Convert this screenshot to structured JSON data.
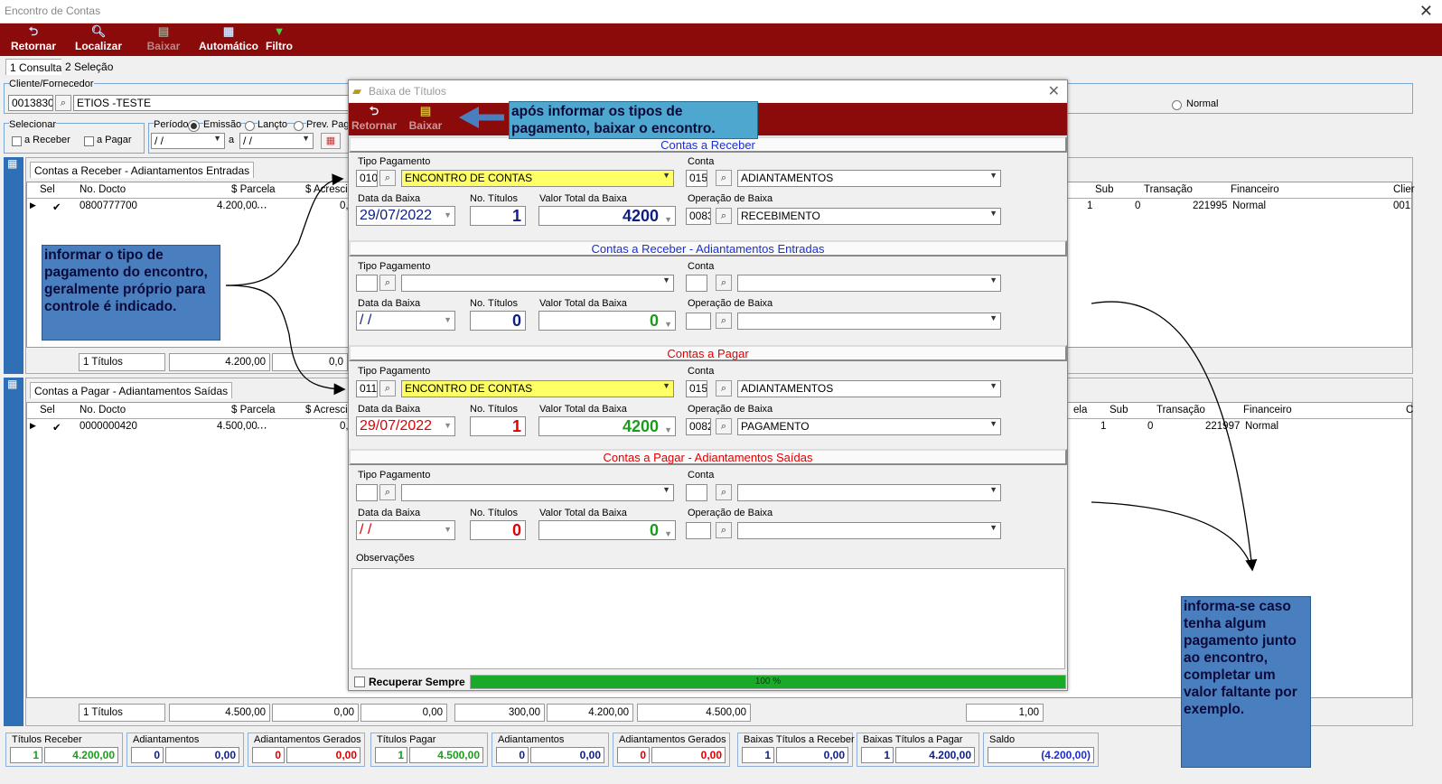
{
  "window": {
    "title": "Encontro de Contas"
  },
  "toolbar": {
    "retornar": "Retornar",
    "localizar": "Localizar",
    "baixar": "Baixar",
    "automatico": "Automático",
    "filtro": "Filtro"
  },
  "tabs": [
    "1 Consulta",
    "2 Seleção"
  ],
  "cliente": {
    "label": "Cliente/Fornecedor",
    "code": "0013830",
    "name": "ETIOS -TESTE",
    "normal": "Normal"
  },
  "selecionar": {
    "label": "Selecionar",
    "receber": "a Receber",
    "pagar": "a Pagar"
  },
  "periodo": {
    "label": "Período",
    "emissao": "Emissão",
    "lancto": "Lançto",
    "prev": "Prev. Pag",
    "de": " / /",
    "a_label": "a",
    "ate": " / /"
  },
  "receber_grid": {
    "tab": "Contas a Receber - Adiantamentos Entradas",
    "headers_left": [
      "Sel",
      "No. Docto",
      "$ Parcela",
      "$ Acrescim"
    ],
    "headers_right": [
      "Sub",
      "Transação",
      "Financeiro",
      "Clier"
    ],
    "row": {
      "docto": "0800777700",
      "parcela": "4.200,00",
      "acresc": "0,0",
      "right_a": "1",
      "sub": "0",
      "transacao": "221995",
      "financeiro": "Normal",
      "clier": "001"
    },
    "foot": {
      "titulos": "1 Títulos",
      "total": "4.200,00",
      "acresc": "0,0"
    }
  },
  "pagar_grid": {
    "tab": "Contas a Pagar - Adiantamentos Saídas",
    "headers_left": [
      "Sel",
      "No. Docto",
      "$ Parcela",
      "$ Acrescim"
    ],
    "headers_right": [
      "ela",
      "Sub",
      "Transação",
      "Financeiro",
      "C"
    ],
    "row": {
      "docto": "0000000420",
      "parcela": "4.500,00",
      "acresc": "0,0",
      "right_a": "1",
      "sub": "0",
      "transacao": "221997",
      "financeiro": "Normal"
    },
    "foot": {
      "titulos": "1 Títulos",
      "v1": "4.500,00",
      "v2": "0,00",
      "v3": "0,00",
      "v4": "300,00",
      "v5": "4.200,00",
      "v6": "4.500,00",
      "v7": "1,00"
    }
  },
  "dialog": {
    "title": "Baixa de Títulos",
    "retornar": "Retornar",
    "baixar": "Baixar",
    "labels": {
      "tipo": "Tipo Pagamento",
      "conta": "Conta",
      "data": "Data da Baixa",
      "titulos": "No. Títulos",
      "valor": "Valor Total da Baixa",
      "operacao": "Operação de Baixa"
    },
    "sec1": {
      "head": "Contas a Receber",
      "tipo_code": "010",
      "tipo_name": "ENCONTRO DE CONTAS",
      "conta_code": "015",
      "conta_name": "ADIANTAMENTOS",
      "data": "29/07/2022",
      "titulos": "1",
      "valor": "4200",
      "op_code": "0083",
      "op_name": "RECEBIMENTO"
    },
    "sec2": {
      "head": "Contas a Receber - Adiantamentos Entradas",
      "data": " / /",
      "titulos": "0",
      "valor": "0"
    },
    "sec3": {
      "head": "Contas a Pagar",
      "tipo_code": "011",
      "tipo_name": "ENCONTRO DE CONTAS",
      "conta_code": "015",
      "conta_name": "ADIANTAMENTOS",
      "data": "29/07/2022",
      "titulos": "1",
      "valor": "4200",
      "op_code": "0082",
      "op_name": "PAGAMENTO"
    },
    "sec4": {
      "head": "Contas a Pagar - Adiantamentos Saídas",
      "data": " / /",
      "titulos": "0",
      "valor": "0"
    },
    "obs_label": "Observações",
    "recuperar": "Recuperar Sempre",
    "progress": "100 %",
    "progress_value": 100
  },
  "notes": {
    "n1": "após informar os tipos de pagamento, baixar o encontro.",
    "n2": "informar o tipo de pagamento do encontro, geralmente próprio para controle é indicado.",
    "n3": "informa-se caso tenha algum pagamento junto ao encontro, completar um valor faltante por exemplo."
  },
  "summary": [
    {
      "label": "Títulos Receber",
      "n": "1",
      "v": "4.200,00",
      "color": "#1c9c1c"
    },
    {
      "label": "Adiantamentos",
      "n": "0",
      "v": "0,00",
      "color": "#0d1e86"
    },
    {
      "label": "Adiantamentos Gerados",
      "n": "0",
      "v": "0,00",
      "color": "#e00000"
    },
    {
      "label": "Títulos Pagar",
      "n": "1",
      "v": "4.500,00",
      "color": "#1c9c1c"
    },
    {
      "label": "Adiantamentos",
      "n": "0",
      "v": "0,00",
      "color": "#0d1e86"
    },
    {
      "label": "Adiantamentos Gerados",
      "n": "0",
      "v": "0,00",
      "color": "#e00000"
    },
    {
      "label": "Baixas Títulos a Receber",
      "n": "1",
      "v": "0,00",
      "color": "#0d1e86"
    },
    {
      "label": "Baixas Títulos a Pagar",
      "n": "1",
      "v": "4.200,00",
      "color": "#0d1e86"
    },
    {
      "label": "Saldo",
      "n": "",
      "v": "(4.200,00)",
      "color": "#1a2fd0"
    }
  ]
}
